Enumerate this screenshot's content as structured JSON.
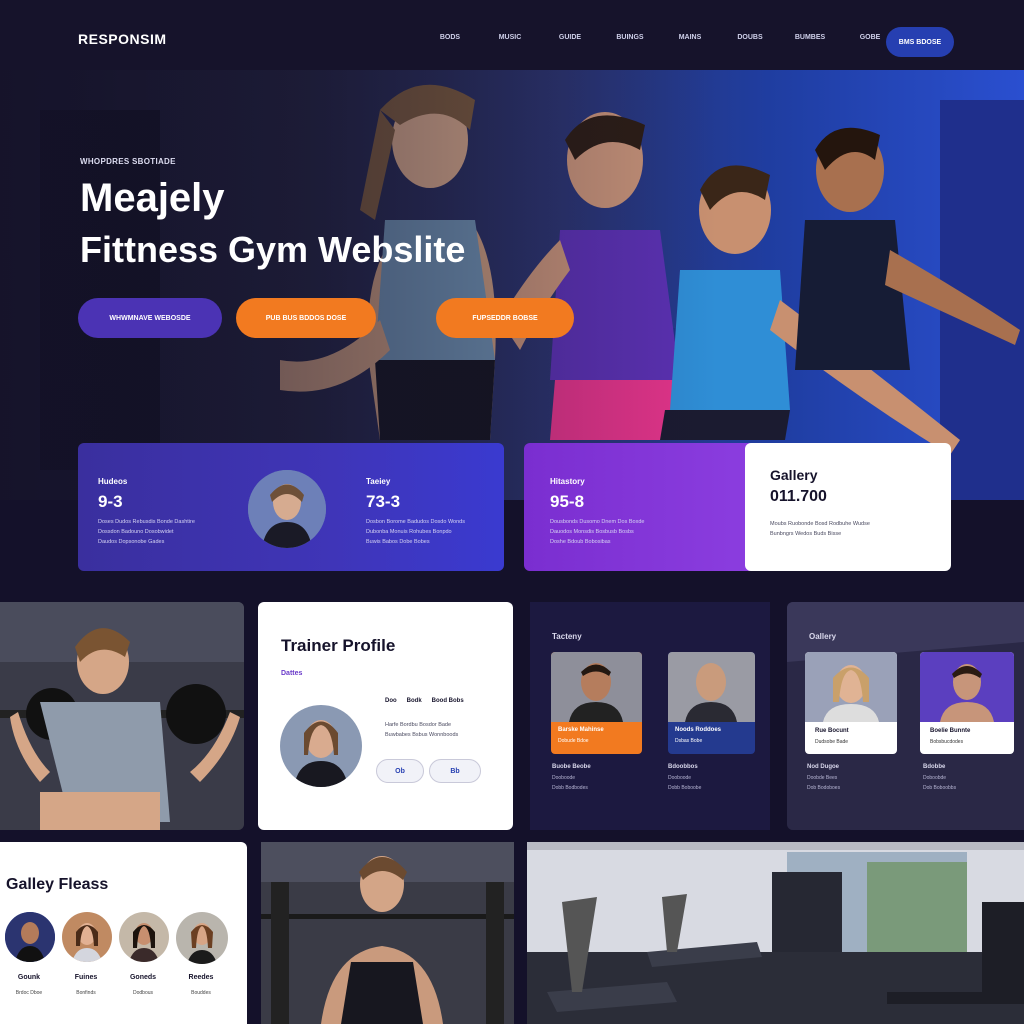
{
  "nav": {
    "logo": "RESPONSIM",
    "links": [
      "BODS",
      "MUSIC",
      "GUIDE",
      "BUINGS",
      "MAINS",
      "DOUBS",
      "BUMBES",
      "GOBE"
    ],
    "cta": "BMS BDOSE"
  },
  "hero": {
    "eyebrow": "WHOPDRES SBOTIADE",
    "title_line1": "Meajely",
    "title_line2": "Fittness Gym Webslite",
    "buttons": [
      "WHWMNAVE WEBOSDE",
      "PUB BUS BDDOS DOSE",
      "FUPSEDDR BOBSE"
    ]
  },
  "stats": [
    {
      "label": "Hudeos",
      "value": "9-3",
      "desc": "Doses Dudos Rebusdis Bonde Dashtire\nDossdon Badouno Dosobwidet\nDaudos Dopsonobe Gades"
    },
    {
      "label": "Taeiey",
      "value": "73-3",
      "desc": "Dosbon Borome Badudos Dosdo Wonds\nDubonba Monuis Rohubes Bonpdo\nBuwis Babos Dobe Bobes"
    },
    {
      "label": "Hitastory",
      "value": "95-8",
      "desc": "Dousbonds Dusomo Dnem Dos Boxde\nDauodos Monsdis Bosbusb Bosbs\nDoshe Bdoub Bobosibas"
    }
  ],
  "gallery_card": {
    "title": "Gallery",
    "value": "011.700",
    "desc": "Moubs Ruobonde Bosd Rodbuhe Wudse\nBunbngrs Wedos Buds Bisse"
  },
  "trainer": {
    "title": "Trainer Profile",
    "subtitle": "Dattes",
    "meta": [
      "Doo",
      "Bodk",
      "Bood Bobs"
    ],
    "desc": "Harfe Bordbu Bosdor Bade\nBuwbabes Bsbus Wonnboods",
    "chips": [
      "Ob",
      "Bb"
    ]
  },
  "team": {
    "title": "Tacteny",
    "cards": [
      {
        "name": "Barske Mahinse",
        "role": "Dobude Bdoe"
      },
      {
        "name": "Noods Roddoes",
        "role": "Dsbas Bobe"
      }
    ],
    "rows": [
      [
        "Buobe Beobe",
        "Dooboode",
        "Dobb Bodbodes"
      ],
      [
        "Bdoobbos",
        "Dooboode",
        "Dobb Boboobe"
      ]
    ]
  },
  "gallery2": {
    "title": "Oallery",
    "cards": [
      {
        "name": "Rue Bocunt",
        "role": "Dudsobe Bade"
      },
      {
        "name": "Boelie Bunnte",
        "role": "Bobsbucdodes"
      }
    ],
    "rows": [
      [
        "Nod Dugoe",
        "Doobde Bees",
        "Dob Bodoboes"
      ],
      [
        "Bdobbe",
        "Doboobde",
        "Dob Boboobbs"
      ]
    ]
  },
  "gallery3": {
    "title": "Galley Fleass",
    "members": [
      {
        "name": "Gounk",
        "meta": "Brdoc Dboe"
      },
      {
        "name": "Fuines",
        "meta": "Bonfinds"
      },
      {
        "name": "Goneds",
        "meta": "Dodbous"
      },
      {
        "name": "Reedes",
        "meta": "Bouddes"
      }
    ]
  },
  "colors": {
    "background": "#14112a",
    "accent_blue": "#263fb1",
    "accent_orange": "#f27a20",
    "accent_purple": "#7a2ed0"
  }
}
